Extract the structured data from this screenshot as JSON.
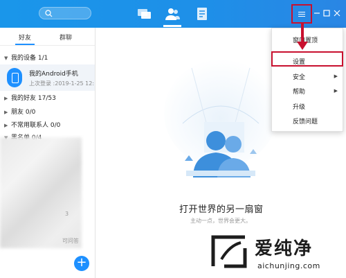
{
  "search": {
    "placeholder": ""
  },
  "nav": {
    "tabs": [
      "messages-icon",
      "contacts-icon",
      "files-icon"
    ]
  },
  "sidebar": {
    "tabs": [
      {
        "label": "好友"
      },
      {
        "label": "群聊"
      }
    ],
    "groups": [
      {
        "label": "我的设备 1/1"
      },
      {
        "label": "我的好友 17/53"
      },
      {
        "label": "朋友 0/0"
      },
      {
        "label": "不常用联系人 0/0"
      },
      {
        "label": "黑名单 0/4"
      }
    ],
    "device": {
      "name": "我的Android手机",
      "sub": "上次登录 :2019-1-25 12:"
    },
    "blur_texts": [
      "3",
      "可问答"
    ]
  },
  "main": {
    "title": "打开世界的另一扇窗",
    "subtitle": "主动一点，世界会更大。"
  },
  "menu": {
    "items": [
      {
        "label": "窗口置顶"
      },
      {
        "label": "设置"
      },
      {
        "label": "安全"
      },
      {
        "label": "帮助"
      },
      {
        "label": "升级"
      },
      {
        "label": "反馈问题"
      }
    ]
  },
  "watermark": {
    "text": "爱纯净",
    "url": "aichunjing.com"
  },
  "colors": {
    "accent": "#1e90ff",
    "highlight": "#c8102e"
  }
}
